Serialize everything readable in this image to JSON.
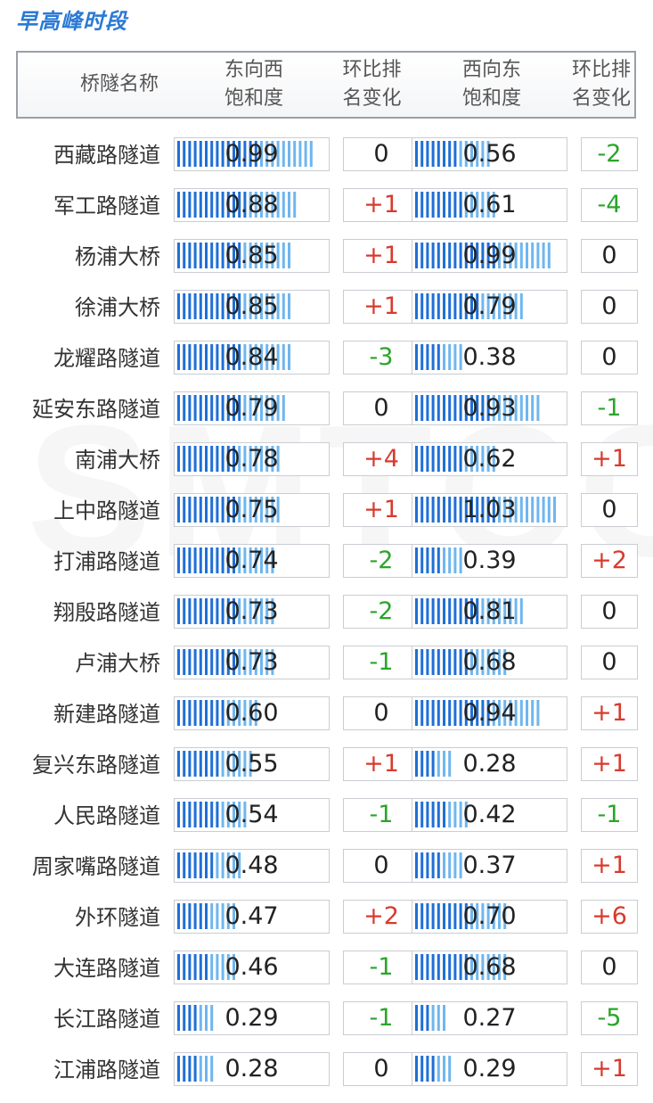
{
  "title": "早高峰时段",
  "watermark": "SMTCC",
  "header": {
    "name": "桥隧名称",
    "ew_sat": [
      "东向西",
      "饱和度"
    ],
    "ew_chg": [
      "环比排",
      "名变化"
    ],
    "we_sat": [
      "西向东",
      "饱和度"
    ],
    "we_chg": [
      "环比排",
      "名变化"
    ]
  },
  "colors": {
    "title": "#2a7ad6",
    "bar_dark": "#1f6fd6",
    "bar_light": "#6fb6ef",
    "up": "#d83a2e",
    "down": "#2aa52a",
    "neutral": "#222222"
  },
  "chart_data": {
    "type": "table",
    "bar_max": 1.05,
    "columns": [
      "桥隧名称",
      "东向西饱和度",
      "环比排名变化",
      "西向东饱和度",
      "环比排名变化"
    ],
    "rows": [
      {
        "name": "西藏路隧道",
        "ew": "0.99",
        "ew_chg": "0",
        "we": "0.56",
        "we_chg": "-2"
      },
      {
        "name": "军工路隧道",
        "ew": "0.88",
        "ew_chg": "+1",
        "we": "0.61",
        "we_chg": "-4"
      },
      {
        "name": "杨浦大桥",
        "ew": "0.85",
        "ew_chg": "+1",
        "we": "0.99",
        "we_chg": "0"
      },
      {
        "name": "徐浦大桥",
        "ew": "0.85",
        "ew_chg": "+1",
        "we": "0.79",
        "we_chg": "0"
      },
      {
        "name": "龙耀路隧道",
        "ew": "0.84",
        "ew_chg": "-3",
        "we": "0.38",
        "we_chg": "0"
      },
      {
        "name": "延安东路隧道",
        "ew": "0.79",
        "ew_chg": "0",
        "we": "0.93",
        "we_chg": "-1"
      },
      {
        "name": "南浦大桥",
        "ew": "0.78",
        "ew_chg": "+4",
        "we": "0.62",
        "we_chg": "+1"
      },
      {
        "name": "上中路隧道",
        "ew": "0.75",
        "ew_chg": "+1",
        "we": "1.03",
        "we_chg": "0"
      },
      {
        "name": "打浦路隧道",
        "ew": "0.74",
        "ew_chg": "-2",
        "we": "0.39",
        "we_chg": "+2"
      },
      {
        "name": "翔殷路隧道",
        "ew": "0.73",
        "ew_chg": "-2",
        "we": "0.81",
        "we_chg": "0"
      },
      {
        "name": "卢浦大桥",
        "ew": "0.73",
        "ew_chg": "-1",
        "we": "0.68",
        "we_chg": "0"
      },
      {
        "name": "新建路隧道",
        "ew": "0.60",
        "ew_chg": "0",
        "we": "0.94",
        "we_chg": "+1"
      },
      {
        "name": "复兴东路隧道",
        "ew": "0.55",
        "ew_chg": "+1",
        "we": "0.28",
        "we_chg": "+1"
      },
      {
        "name": "人民路隧道",
        "ew": "0.54",
        "ew_chg": "-1",
        "we": "0.42",
        "we_chg": "-1"
      },
      {
        "name": "周家嘴路隧道",
        "ew": "0.48",
        "ew_chg": "0",
        "we": "0.37",
        "we_chg": "+1"
      },
      {
        "name": "外环隧道",
        "ew": "0.47",
        "ew_chg": "+2",
        "we": "0.70",
        "we_chg": "+6"
      },
      {
        "name": "大连路隧道",
        "ew": "0.46",
        "ew_chg": "-1",
        "we": "0.68",
        "we_chg": "0"
      },
      {
        "name": "长江路隧道",
        "ew": "0.29",
        "ew_chg": "-1",
        "we": "0.27",
        "we_chg": "-5"
      },
      {
        "name": "江浦路隧道",
        "ew": "0.28",
        "ew_chg": "0",
        "we": "0.29",
        "we_chg": "+1"
      }
    ]
  }
}
